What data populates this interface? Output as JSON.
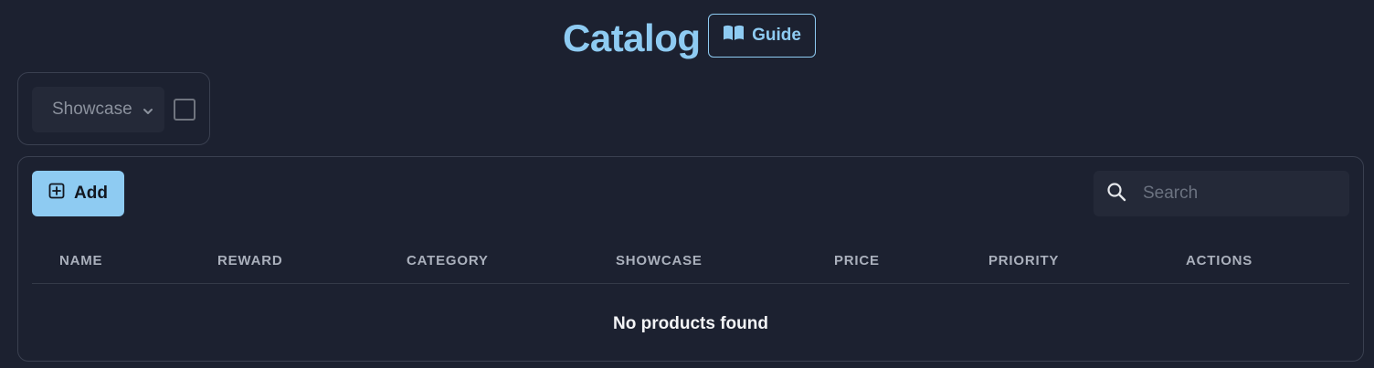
{
  "header": {
    "title": "Catalog",
    "guide_label": "Guide",
    "guide_icon": "book-open-icon"
  },
  "filters": {
    "showcase_select": "Showcase",
    "select_icon": "chevron-down-icon",
    "checkbox_checked": false
  },
  "toolbar": {
    "add_label": "Add",
    "add_icon": "plus-square-icon",
    "search_placeholder": "Search",
    "search_value": "",
    "search_icon": "search-icon"
  },
  "table": {
    "columns": [
      "NAME",
      "REWARD",
      "CATEGORY",
      "SHOWCASE",
      "PRICE",
      "PRIORITY",
      "ACTIONS"
    ],
    "rows": [],
    "empty_message": "No products found"
  },
  "colors": {
    "background": "#1c2130",
    "accent": "#8ecbf2",
    "surface": "#242938",
    "border": "#3a4050"
  }
}
